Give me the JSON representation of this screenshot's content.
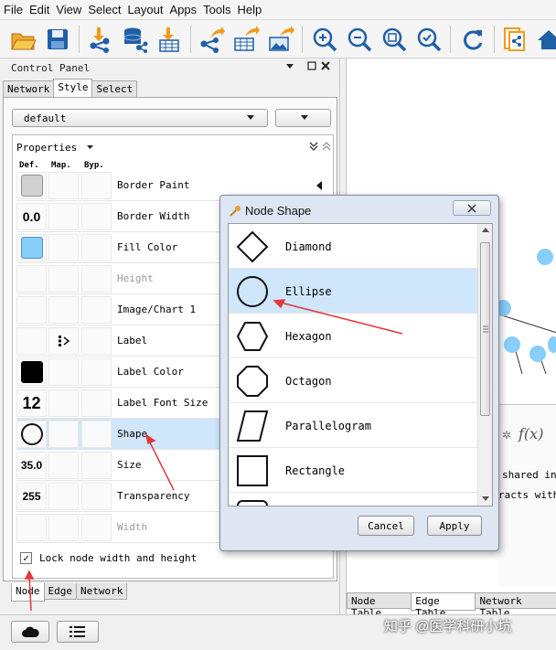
{
  "menu": [
    "File",
    "Edit",
    "View",
    "Select",
    "Layout",
    "Apps",
    "Tools",
    "Help"
  ],
  "control_panel": {
    "title": "Control Panel",
    "tabs": [
      "Network",
      "Style",
      "Select"
    ],
    "active_tab": "Style",
    "style_dropdown": "default",
    "properties_label": "Properties",
    "columns": [
      "Def.",
      "Map.",
      "Byp."
    ],
    "rows": [
      {
        "def": "",
        "label": "Border Paint"
      },
      {
        "def": "0.0",
        "label": "Border Width"
      },
      {
        "def": "",
        "label": "Fill Color"
      },
      {
        "def": "",
        "label": "Height"
      },
      {
        "def": "",
        "label": "Image/Chart 1"
      },
      {
        "def": "",
        "label": "Label"
      },
      {
        "def": "",
        "label": "Label Color"
      },
      {
        "def": "12",
        "label": "Label Font Size"
      },
      {
        "def": "",
        "label": "Shape"
      },
      {
        "def": "35.0",
        "label": "Size"
      },
      {
        "def": "255",
        "label": "Transparency"
      },
      {
        "def": "",
        "label": "Width"
      }
    ],
    "lock_label": "Lock node width and height",
    "lock_checked": "✓",
    "bottom_tabs": [
      "Node",
      "Edge",
      "Network"
    ]
  },
  "dialog": {
    "title": "Node Shape",
    "shapes": [
      "Diamond",
      "Ellipse",
      "Hexagon",
      "Octagon",
      "Parallelogram",
      "Rectangle"
    ],
    "selected": "Ellipse",
    "cancel": "Cancel",
    "apply": "Apply"
  },
  "right_panel": {
    "func_label": "f(x)",
    "text1": "shared int",
    "text2": "racts with",
    "tabs": [
      "Node Table",
      "Edge Table",
      "Network Table"
    ]
  },
  "colors": {
    "fill": "#87cefa",
    "selection": "#cfe6fb",
    "arrow": "#e0393e"
  },
  "watermark": "知乎 @医学科研小坑"
}
